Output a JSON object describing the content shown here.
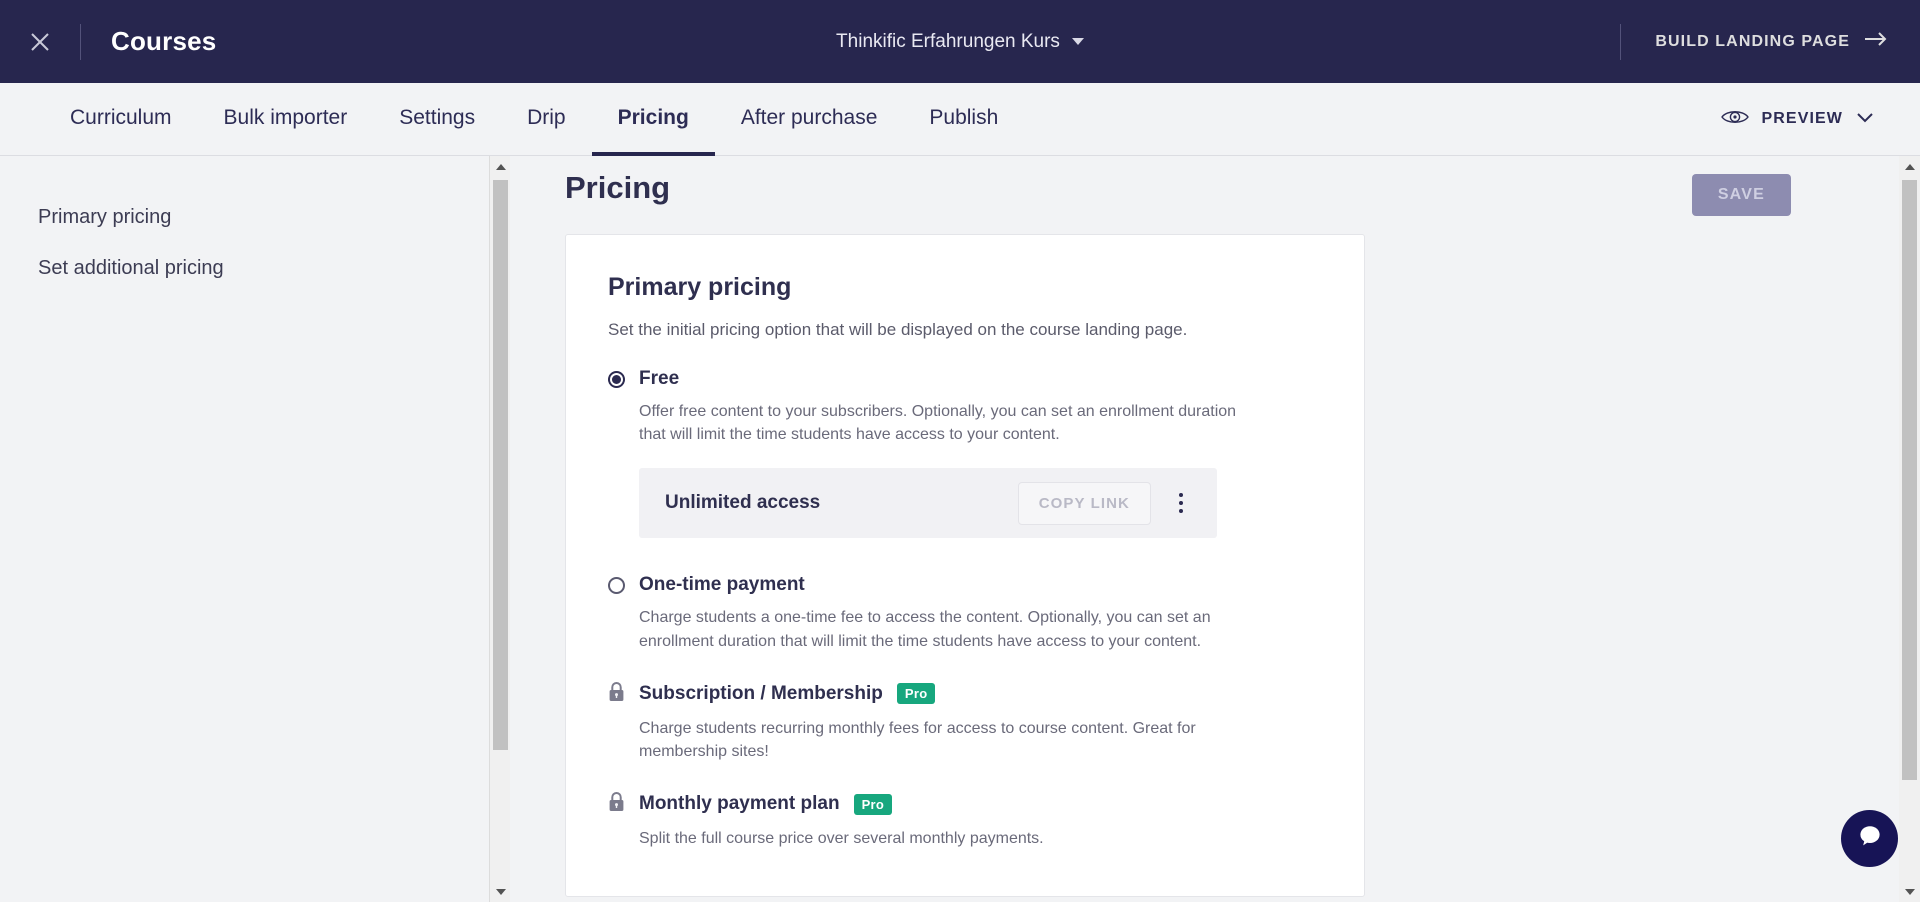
{
  "topbar": {
    "close_icon": "close-icon",
    "title": "Courses",
    "course_name": "Thinkific Erfahrungen Kurs",
    "build_landing_page": "BUILD LANDING PAGE",
    "arrow_icon": "arrow-right-icon",
    "bg_color": "#27264e"
  },
  "tabbar": {
    "tabs": [
      {
        "label": "Curriculum",
        "active": false
      },
      {
        "label": "Bulk importer",
        "active": false
      },
      {
        "label": "Settings",
        "active": false
      },
      {
        "label": "Drip",
        "active": false
      },
      {
        "label": "Pricing",
        "active": true
      },
      {
        "label": "After purchase",
        "active": false
      },
      {
        "label": "Publish",
        "active": false
      }
    ],
    "preview_label": "PREVIEW",
    "preview_icon": "eye-icon",
    "preview_caret": "chevron-down-icon"
  },
  "sidebar": {
    "items": [
      {
        "label": "Primary pricing"
      },
      {
        "label": "Set additional pricing"
      }
    ]
  },
  "main": {
    "page_title": "Pricing",
    "save_label": "SAVE",
    "card": {
      "title": "Primary pricing",
      "subtitle": "Set the initial pricing option that will be displayed on the course landing page.",
      "options": [
        {
          "label": "Free",
          "selected": true,
          "locked": false,
          "pro": false,
          "description": "Offer free content to your subscribers. Optionally, you can set an enrollment duration that will limit the time students have access to your content."
        },
        {
          "label": "One-time payment",
          "selected": false,
          "locked": false,
          "pro": false,
          "description": "Charge students a one-time fee to access the content. Optionally, you can set an enrollment duration that will limit the time students have access to your content."
        },
        {
          "label": "Subscription / Membership",
          "selected": false,
          "locked": true,
          "pro": true,
          "pro_badge": "Pro",
          "description": "Charge students recurring monthly fees for access to course content. Great for membership sites!"
        },
        {
          "label": "Monthly payment plan",
          "selected": false,
          "locked": true,
          "pro": true,
          "pro_badge": "Pro",
          "description": "Split the full course price over several monthly payments."
        }
      ],
      "access_row": {
        "label": "Unlimited access",
        "copy_link_label": "COPY LINK",
        "kebab_icon": "more-vertical-icon"
      }
    }
  },
  "chat": {
    "icon": "chat-bubble-icon",
    "color": "#171456"
  },
  "colors": {
    "accent": "#27264e",
    "pro_badge": "#17a77e",
    "save_disabled": "#8d8cb0",
    "page_bg": "#f2f3f5"
  }
}
